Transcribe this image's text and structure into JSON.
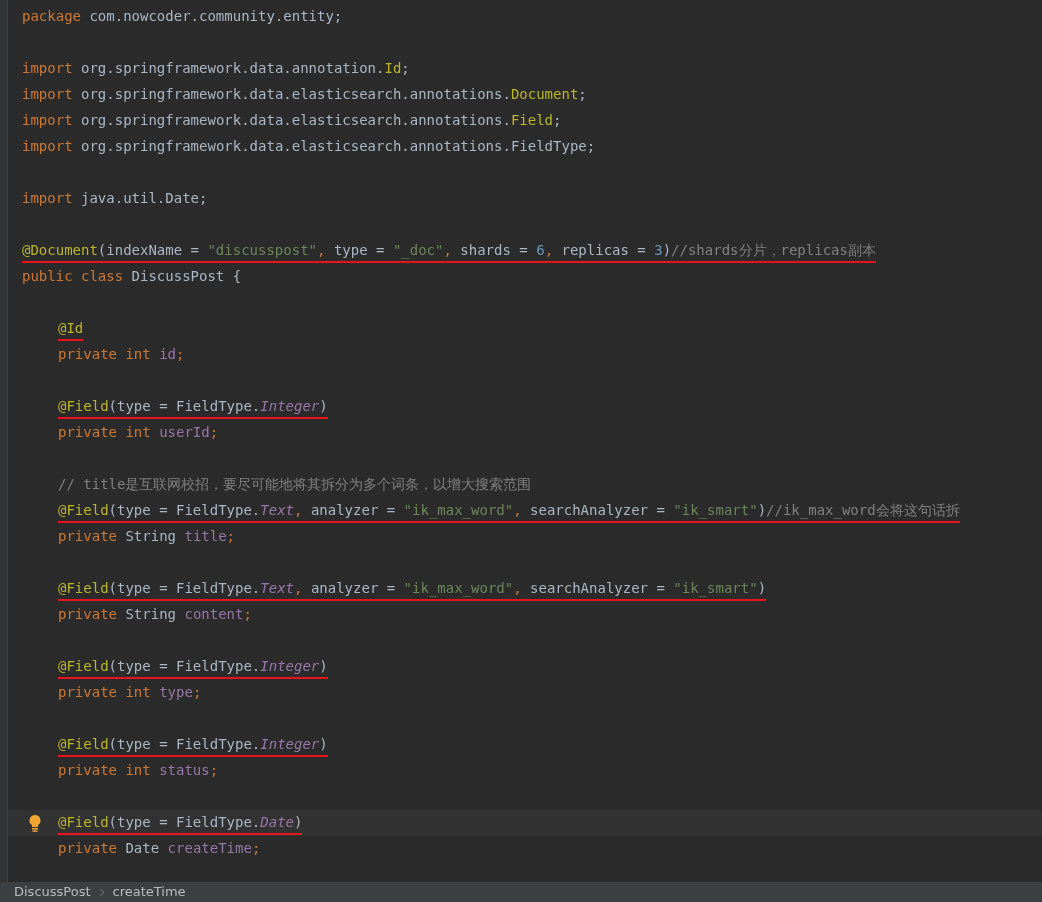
{
  "editor": {
    "lines": [
      {
        "kind": "code",
        "tokens": [
          {
            "kind": "keyword",
            "text": "package "
          },
          {
            "kind": "plain",
            "text": "com.nowcoder.community.entity;"
          }
        ]
      },
      {
        "kind": "blank"
      },
      {
        "kind": "code",
        "tokens": [
          {
            "kind": "keyword",
            "text": "import "
          },
          {
            "kind": "plain",
            "text": "org.springframework.data.annotation."
          },
          {
            "kind": "annotation",
            "text": "Id"
          },
          {
            "kind": "plain",
            "text": ";"
          }
        ]
      },
      {
        "kind": "code",
        "tokens": [
          {
            "kind": "keyword",
            "text": "import "
          },
          {
            "kind": "plain",
            "text": "org.springframework.data.elasticsearch.annotations."
          },
          {
            "kind": "annotation",
            "text": "Document"
          },
          {
            "kind": "plain",
            "text": ";"
          }
        ]
      },
      {
        "kind": "code",
        "tokens": [
          {
            "kind": "keyword",
            "text": "import "
          },
          {
            "kind": "plain",
            "text": "org.springframework.data.elasticsearch.annotations."
          },
          {
            "kind": "annotation",
            "text": "Field"
          },
          {
            "kind": "plain",
            "text": ";"
          }
        ]
      },
      {
        "kind": "code",
        "tokens": [
          {
            "kind": "keyword",
            "text": "import "
          },
          {
            "kind": "plain",
            "text": "org.springframework.data.elasticsearch.annotations.FieldType;"
          }
        ]
      },
      {
        "kind": "blank"
      },
      {
        "kind": "code",
        "tokens": [
          {
            "kind": "keyword",
            "text": "import "
          },
          {
            "kind": "plain",
            "text": "java.util.Date;"
          }
        ]
      },
      {
        "kind": "blank"
      },
      {
        "kind": "code",
        "underlined": true,
        "tokens": [
          {
            "kind": "annotation",
            "text": "@Document"
          },
          {
            "kind": "plain",
            "text": "(indexName = "
          },
          {
            "kind": "string",
            "text": "\"discusspost\""
          },
          {
            "kind": "keyword",
            "text": ", "
          },
          {
            "kind": "plain",
            "text": "type = "
          },
          {
            "kind": "string",
            "text": "\"_doc\""
          },
          {
            "kind": "keyword",
            "text": ", "
          },
          {
            "kind": "plain",
            "text": "shards = "
          },
          {
            "kind": "number",
            "text": "6"
          },
          {
            "kind": "keyword",
            "text": ", "
          },
          {
            "kind": "plain",
            "text": "replicas = "
          },
          {
            "kind": "number",
            "text": "3"
          },
          {
            "kind": "plain",
            "text": ")"
          },
          {
            "kind": "comment",
            "text": "//shards分片，replicas副本"
          }
        ]
      },
      {
        "kind": "code",
        "tokens": [
          {
            "kind": "keyword",
            "text": "public class "
          },
          {
            "kind": "plain",
            "text": "DiscussPost {"
          }
        ]
      },
      {
        "kind": "blank"
      },
      {
        "kind": "code",
        "indented": true,
        "underlined": true,
        "tokens": [
          {
            "kind": "annotation",
            "text": "@Id"
          }
        ]
      },
      {
        "kind": "code",
        "indented": true,
        "tokens": [
          {
            "kind": "keyword",
            "text": "private int "
          },
          {
            "kind": "field",
            "text": "id"
          },
          {
            "kind": "keyword",
            "text": ";"
          }
        ]
      },
      {
        "kind": "blank"
      },
      {
        "kind": "code",
        "indented": true,
        "underlined": true,
        "tokens": [
          {
            "kind": "annotation",
            "text": "@Field"
          },
          {
            "kind": "plain",
            "text": "(type = FieldType."
          },
          {
            "kind": "constant",
            "text": "Integer"
          },
          {
            "kind": "plain",
            "text": ")"
          }
        ]
      },
      {
        "kind": "code",
        "indented": true,
        "tokens": [
          {
            "kind": "keyword",
            "text": "private int "
          },
          {
            "kind": "field",
            "text": "userId"
          },
          {
            "kind": "keyword",
            "text": ";"
          }
        ]
      },
      {
        "kind": "blank"
      },
      {
        "kind": "code",
        "indented": true,
        "tokens": [
          {
            "kind": "comment",
            "text": "// title是互联网校招，要尽可能地将其拆分为多个词条，以增大搜索范围"
          }
        ]
      },
      {
        "kind": "code",
        "indented": true,
        "underlined": true,
        "tokens": [
          {
            "kind": "annotation",
            "text": "@Field"
          },
          {
            "kind": "plain",
            "text": "(type = FieldType."
          },
          {
            "kind": "constant",
            "text": "Text"
          },
          {
            "kind": "keyword",
            "text": ", "
          },
          {
            "kind": "plain",
            "text": "analyzer = "
          },
          {
            "kind": "string",
            "text": "\"ik_max_word\""
          },
          {
            "kind": "keyword",
            "text": ", "
          },
          {
            "kind": "plain",
            "text": "searchAnalyzer = "
          },
          {
            "kind": "string",
            "text": "\"ik_smart\""
          },
          {
            "kind": "plain",
            "text": ")"
          },
          {
            "kind": "comment",
            "text": "//ik_max_word会将这句话拆"
          }
        ]
      },
      {
        "kind": "code",
        "indented": true,
        "tokens": [
          {
            "kind": "keyword",
            "text": "private "
          },
          {
            "kind": "plain",
            "text": "String "
          },
          {
            "kind": "field",
            "text": "title"
          },
          {
            "kind": "keyword",
            "text": ";"
          }
        ]
      },
      {
        "kind": "blank"
      },
      {
        "kind": "code",
        "indented": true,
        "underlined": true,
        "tokens": [
          {
            "kind": "annotation",
            "text": "@Field"
          },
          {
            "kind": "plain",
            "text": "(type = FieldType."
          },
          {
            "kind": "constant",
            "text": "Text"
          },
          {
            "kind": "keyword",
            "text": ", "
          },
          {
            "kind": "plain",
            "text": "analyzer = "
          },
          {
            "kind": "string",
            "text": "\"ik_max_word\""
          },
          {
            "kind": "keyword",
            "text": ", "
          },
          {
            "kind": "plain",
            "text": "searchAnalyzer = "
          },
          {
            "kind": "string",
            "text": "\"ik_smart\""
          },
          {
            "kind": "plain",
            "text": ")"
          }
        ]
      },
      {
        "kind": "code",
        "indented": true,
        "tokens": [
          {
            "kind": "keyword",
            "text": "private "
          },
          {
            "kind": "plain",
            "text": "String "
          },
          {
            "kind": "field",
            "text": "content"
          },
          {
            "kind": "keyword",
            "text": ";"
          }
        ]
      },
      {
        "kind": "blank"
      },
      {
        "kind": "code",
        "indented": true,
        "underlined": true,
        "tokens": [
          {
            "kind": "annotation",
            "text": "@Field"
          },
          {
            "kind": "plain",
            "text": "(type = FieldType."
          },
          {
            "kind": "constant",
            "text": "Integer"
          },
          {
            "kind": "plain",
            "text": ")"
          }
        ]
      },
      {
        "kind": "code",
        "indented": true,
        "tokens": [
          {
            "kind": "keyword",
            "text": "private int "
          },
          {
            "kind": "field",
            "text": "type"
          },
          {
            "kind": "keyword",
            "text": ";"
          }
        ]
      },
      {
        "kind": "blank"
      },
      {
        "kind": "code",
        "indented": true,
        "underlined": true,
        "tokens": [
          {
            "kind": "annotation",
            "text": "@Field"
          },
          {
            "kind": "plain",
            "text": "(type = FieldType."
          },
          {
            "kind": "constant",
            "text": "Integer"
          },
          {
            "kind": "plain",
            "text": ")"
          }
        ]
      },
      {
        "kind": "code",
        "indented": true,
        "tokens": [
          {
            "kind": "keyword",
            "text": "private int "
          },
          {
            "kind": "field",
            "text": "status"
          },
          {
            "kind": "keyword",
            "text": ";"
          }
        ]
      },
      {
        "kind": "blank"
      },
      {
        "kind": "code",
        "indented": true,
        "underlined": true,
        "current": true,
        "hint": true,
        "tokens": [
          {
            "kind": "annotation",
            "text": "@Field"
          },
          {
            "kind": "plain",
            "text": "(type = FieldType."
          },
          {
            "kind": "constant",
            "text": "Date"
          },
          {
            "kind": "plain",
            "text": ")"
          }
        ]
      },
      {
        "kind": "code",
        "indented": true,
        "tokens": [
          {
            "kind": "keyword",
            "text": "private "
          },
          {
            "kind": "plain",
            "text": "Date "
          },
          {
            "kind": "field",
            "text": "createTime"
          },
          {
            "kind": "keyword",
            "text": ";"
          }
        ]
      }
    ]
  },
  "breadcrumbs": [
    "DiscussPost",
    "createTime"
  ]
}
